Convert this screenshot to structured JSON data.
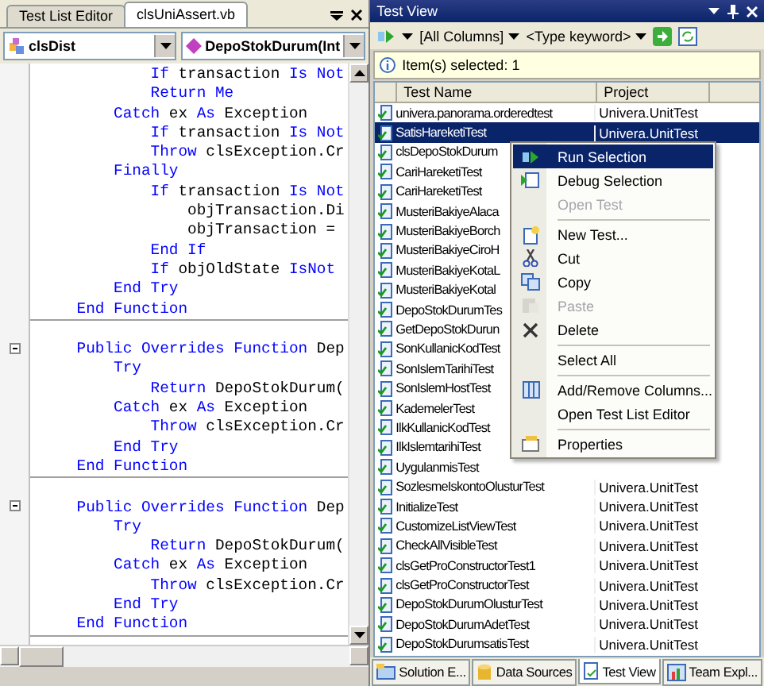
{
  "editor": {
    "tabs": [
      {
        "label": "Test List Editor",
        "selected": false
      },
      {
        "label": "clsUniAssert.vb",
        "selected": true
      }
    ],
    "class_combo": {
      "value": "clsDist"
    },
    "member_combo": {
      "value": "DepoStokDurum(Int"
    },
    "blocks": [
      {
        "collapsible": false,
        "lines": [
          [
            {
              "kind": "kw",
              "text": "            If"
            },
            {
              "kind": "plain",
              "text": " transaction "
            },
            {
              "kind": "kw",
              "text": "Is Not"
            }
          ],
          [
            {
              "kind": "kw",
              "text": "            Return Me"
            }
          ],
          [
            {
              "kind": "kw",
              "text": "        Catch"
            },
            {
              "kind": "plain",
              "text": " ex "
            },
            {
              "kind": "kw",
              "text": "As"
            },
            {
              "kind": "plain",
              "text": " Exception"
            }
          ],
          [
            {
              "kind": "kw",
              "text": "            If"
            },
            {
              "kind": "plain",
              "text": " transaction "
            },
            {
              "kind": "kw",
              "text": "Is Not"
            }
          ],
          [
            {
              "kind": "kw",
              "text": "            Throw"
            },
            {
              "kind": "plain",
              "text": " clsException.Cr"
            }
          ],
          [
            {
              "kind": "kw",
              "text": "        Finally"
            }
          ],
          [
            {
              "kind": "kw",
              "text": "            If"
            },
            {
              "kind": "plain",
              "text": " transaction "
            },
            {
              "kind": "kw",
              "text": "Is Not"
            }
          ],
          [
            {
              "kind": "plain",
              "text": "                objTransaction.Di"
            }
          ],
          [
            {
              "kind": "plain",
              "text": "                objTransaction = "
            }
          ],
          [
            {
              "kind": "kw",
              "text": "            End If"
            }
          ],
          [
            {
              "kind": "kw",
              "text": "            If"
            },
            {
              "kind": "plain",
              "text": " objOldState "
            },
            {
              "kind": "kw",
              "text": "IsNot"
            }
          ],
          [
            {
              "kind": "kw",
              "text": "        End Try"
            }
          ],
          [
            {
              "kind": "kw",
              "text": "    End Function"
            }
          ]
        ]
      },
      {
        "collapsible": true,
        "lines": [
          [
            {
              "kind": "kw",
              "text": "    Public Overrides Function"
            },
            {
              "kind": "plain",
              "text": " Dep"
            }
          ],
          [
            {
              "kind": "kw",
              "text": "        Try"
            }
          ],
          [
            {
              "kind": "kw",
              "text": "            Return"
            },
            {
              "kind": "plain",
              "text": " DepoStokDurum("
            }
          ],
          [
            {
              "kind": "kw",
              "text": "        Catch"
            },
            {
              "kind": "plain",
              "text": " ex "
            },
            {
              "kind": "kw",
              "text": "As"
            },
            {
              "kind": "plain",
              "text": " Exception"
            }
          ],
          [
            {
              "kind": "kw",
              "text": "            Throw"
            },
            {
              "kind": "plain",
              "text": " clsException.Cr"
            }
          ],
          [
            {
              "kind": "kw",
              "text": "        End Try"
            }
          ],
          [
            {
              "kind": "kw",
              "text": "    End Function"
            }
          ]
        ]
      },
      {
        "collapsible": true,
        "lines": [
          [
            {
              "kind": "kw",
              "text": "    Public Overrides Function"
            },
            {
              "kind": "plain",
              "text": " Dep"
            }
          ],
          [
            {
              "kind": "kw",
              "text": "        Try"
            }
          ],
          [
            {
              "kind": "kw",
              "text": "            Return"
            },
            {
              "kind": "plain",
              "text": " DepoStokDurum("
            }
          ],
          [
            {
              "kind": "kw",
              "text": "        Catch"
            },
            {
              "kind": "plain",
              "text": " ex "
            },
            {
              "kind": "kw",
              "text": "As"
            },
            {
              "kind": "plain",
              "text": " Exception"
            }
          ],
          [
            {
              "kind": "kw",
              "text": "            Throw"
            },
            {
              "kind": "plain",
              "text": " clsException.Cr"
            }
          ],
          [
            {
              "kind": "kw",
              "text": "        End Try"
            }
          ],
          [
            {
              "kind": "kw",
              "text": "    End Function"
            }
          ]
        ]
      }
    ]
  },
  "test_view": {
    "title": "Test View",
    "column_filter": "[All Columns]",
    "keyword": {
      "placeholder": "<Type keyword>"
    },
    "info": "Item(s) selected: 1",
    "columns": [
      "Test Name",
      "Project"
    ],
    "rows": [
      {
        "name": "univera.panorama.orderedtest",
        "project": "Univera.UnitTest",
        "selected": false
      },
      {
        "name": "SatisHareketiTest",
        "project": "Univera.UnitTest",
        "selected": true
      },
      {
        "name": "clsDepoStokDurum",
        "selected": false
      },
      {
        "name": "CariHareketiTest",
        "selected": false
      },
      {
        "name": "CariHareketiTest",
        "selected": false
      },
      {
        "name": "MusteriBakiyeAlaca",
        "selected": false
      },
      {
        "name": "MusteriBakiyeBorch",
        "selected": false
      },
      {
        "name": "MusteriBakiyeCiroH",
        "selected": false
      },
      {
        "name": "MusteriBakiyeKotaL",
        "selected": false
      },
      {
        "name": "MusteriBakiyeKotal",
        "selected": false
      },
      {
        "name": "DepoStokDurumTes",
        "selected": false
      },
      {
        "name": "GetDepoStokDurun",
        "selected": false
      },
      {
        "name": "SonKullanicKodTest",
        "selected": false
      },
      {
        "name": "SonIslemTarihiTest",
        "selected": false
      },
      {
        "name": "SonIslemHostTest",
        "selected": false
      },
      {
        "name": "KademelerTest",
        "selected": false
      },
      {
        "name": "IlkKullanicKodTest",
        "selected": false
      },
      {
        "name": "IlkIslemtarihiTest",
        "selected": false
      },
      {
        "name": "UygulanmisTest",
        "selected": false
      },
      {
        "name": "SozlesmeIskontoOlusturTest",
        "project": "Univera.UnitTest",
        "selected": false
      },
      {
        "name": "InitializeTest",
        "project": "Univera.UnitTest",
        "selected": false
      },
      {
        "name": "CustomizeListViewTest",
        "project": "Univera.UnitTest",
        "selected": false
      },
      {
        "name": "CheckAllVisibleTest",
        "project": "Univera.UnitTest",
        "selected": false
      },
      {
        "name": "clsGetProConstructorTest1",
        "project": "Univera.UnitTest",
        "selected": false
      },
      {
        "name": "clsGetProConstructorTest",
        "project": "Univera.UnitTest",
        "selected": false
      },
      {
        "name": "DepoStokDurumOlusturTest",
        "project": "Univera.UnitTest",
        "selected": false
      },
      {
        "name": "DepoStokDurumAdetTest",
        "project": "Univera.UnitTest",
        "selected": false
      },
      {
        "name": "DepoStokDurumsatisTest",
        "project": "Univera.UnitTest",
        "selected": false
      }
    ]
  },
  "context_menu": [
    {
      "kind": "item",
      "label": "Run Selection",
      "selected": true,
      "disabled": false
    },
    {
      "kind": "item",
      "label": "Debug Selection",
      "selected": false,
      "disabled": false
    },
    {
      "kind": "item",
      "label": "Open Test",
      "selected": false,
      "disabled": true
    },
    {
      "kind": "separator"
    },
    {
      "kind": "item",
      "label": "New Test...",
      "selected": false,
      "disabled": false
    },
    {
      "kind": "item",
      "label": "Cut",
      "selected": false,
      "disabled": false
    },
    {
      "kind": "item",
      "label": "Copy",
      "selected": false,
      "disabled": false
    },
    {
      "kind": "item",
      "label": "Paste",
      "selected": false,
      "disabled": true
    },
    {
      "kind": "item",
      "label": "Delete",
      "selected": false,
      "disabled": false
    },
    {
      "kind": "separator"
    },
    {
      "kind": "item",
      "label": "Select All",
      "selected": false,
      "disabled": false
    },
    {
      "kind": "separator"
    },
    {
      "kind": "item",
      "label": "Add/Remove Columns...",
      "selected": false,
      "disabled": false
    },
    {
      "kind": "item",
      "label": "Open Test List Editor",
      "selected": false,
      "disabled": false
    },
    {
      "kind": "separator"
    },
    {
      "kind": "item",
      "label": "Properties",
      "selected": false,
      "disabled": false
    }
  ],
  "bottom_tabs": [
    {
      "label": "Solution E...",
      "selected": false
    },
    {
      "label": "Data Sources",
      "selected": false
    },
    {
      "label": "Test View",
      "selected": true
    },
    {
      "label": "Team Expl...",
      "selected": false
    }
  ]
}
